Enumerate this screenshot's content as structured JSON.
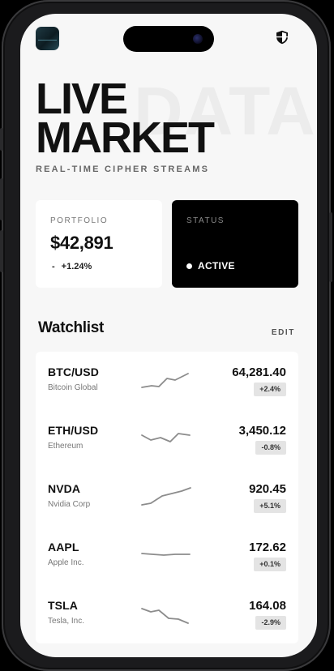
{
  "header": {
    "title_line1": "LIVE",
    "title_line2": "MARKET",
    "title_watermark": "DATA",
    "subtitle": "REAL-TIME CIPHER STREAMS",
    "app_icon": "app-thumbnail",
    "shield_icon": "shield-icon"
  },
  "portfolio": {
    "label": "PORTFOLIO",
    "value": "$42,891",
    "change_prefix": "-",
    "change": "+1.24%"
  },
  "status": {
    "label": "STATUS",
    "value": "ACTIVE"
  },
  "watchlist": {
    "title": "Watchlist",
    "edit_label": "EDIT",
    "items": [
      {
        "symbol": "BTC/USD",
        "name": "Bitcoin Global",
        "price": "64,281.40",
        "change": "+2.4%"
      },
      {
        "symbol": "ETH/USD",
        "name": "Ethereum",
        "price": "3,450.12",
        "change": "-0.8%"
      },
      {
        "symbol": "NVDA",
        "name": "Nvidia Corp",
        "price": "920.45",
        "change": "+5.1%"
      },
      {
        "symbol": "AAPL",
        "name": "Apple Inc.",
        "price": "172.62",
        "change": "+0.1%"
      },
      {
        "symbol": "TSLA",
        "name": "Tesla, Inc.",
        "price": "164.08",
        "change": "-2.9%"
      }
    ]
  },
  "colors": {
    "screen_bg": "#f7f7f7",
    "card_bg": "#ffffff",
    "status_bg": "#000000",
    "badge_bg": "#e4e4e4",
    "sparkline": "#8c8c8c"
  }
}
